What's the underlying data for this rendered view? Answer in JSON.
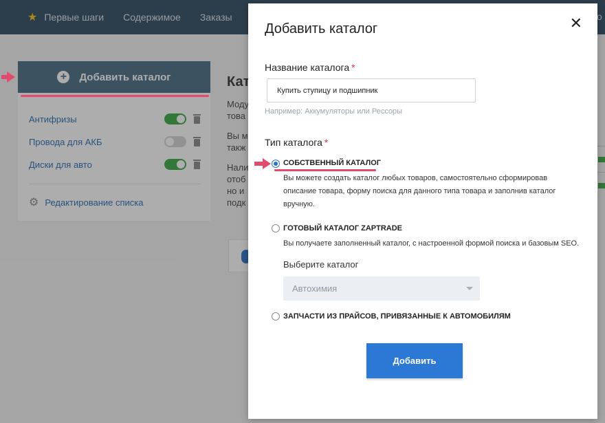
{
  "nav": {
    "items": [
      "Первые шаги",
      "Содержимое",
      "Заказы"
    ],
    "edge_fragment": "о"
  },
  "sidebar": {
    "add_label": "Добавить каталог",
    "catalogs": [
      {
        "label": "Антифризы",
        "enabled": true
      },
      {
        "label": "Провода для АКБ",
        "enabled": false
      },
      {
        "label": "Диски для авто",
        "enabled": true
      }
    ],
    "edit_label": "Редактирование списка"
  },
  "background": {
    "heading_fragment": "Кат",
    "paragraphs": [
      "Моду това",
      "Вы м такж",
      "Нали отоб но и подк"
    ]
  },
  "modal": {
    "title": "Добавить каталог",
    "close_glyph": "✕",
    "name_label": "Название каталога",
    "required_mark": "*",
    "name_value": "Купить ступицу и подшипник",
    "name_hint": "Например: Аккумуляторы или Рессоры",
    "type_label": "Тип каталога",
    "options": [
      {
        "title": "СОБСТВЕННЫЙ КАТАЛОГ",
        "checked": true,
        "description": "Вы можете создать каталог любых товаров, самостоятельно сформировав описание товара, форму поиска для данного типа товара и заполнив каталог вручную."
      },
      {
        "title": "ГОТОВЫЙ КАТАЛОГ ZAPTRADE",
        "checked": false,
        "description": "Вы получаете заполненный каталог, с настроенной формой поиска и базовым SEO."
      },
      {
        "title": "ЗАПЧАСТИ ИЗ ПРАЙСОВ, ПРИВЯЗАННЫЕ К АВТОМОБИЛЯМ",
        "checked": false,
        "description": ""
      }
    ],
    "select_label": "Выберите каталог",
    "select_value": "Автохимия",
    "submit_label": "Добавить"
  },
  "icons": {
    "nav_star": "star-icon",
    "add": "plus-circle-icon",
    "trash": "trash-icon",
    "settings": "gear-icon",
    "close": "close-icon",
    "dropdown": "chevron-down-icon",
    "pointer": "arrow-right-icon"
  },
  "colors": {
    "nav_bg": "#2f4d63",
    "add_button_bg": "#4a6c84",
    "link": "#2b6cb0",
    "toggle_on": "#3aa845",
    "accent_red": "#e44a6c",
    "primary": "#2b79d4"
  }
}
